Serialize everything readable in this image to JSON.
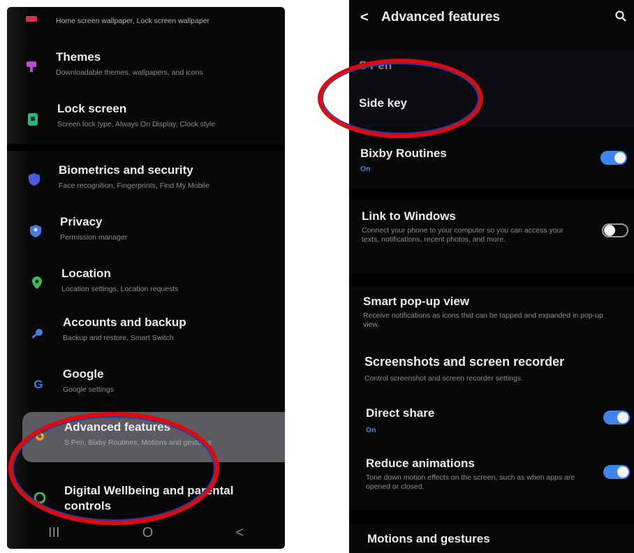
{
  "left_screen": {
    "items": [
      {
        "title": "",
        "subtitle": "Home screen wallpaper, Lock screen wallpaper",
        "icon": "wallpaper-icon",
        "color": "#d9334a"
      },
      {
        "title": "Themes",
        "subtitle": "Downloadable themes, wallpapers, and icons",
        "icon": "themes-icon",
        "color": "#b64fd6"
      },
      {
        "title": "Lock screen",
        "subtitle": "Screen lock type, Always On Display, Clock style",
        "icon": "lock-screen-icon",
        "color": "#2ab38a"
      },
      {
        "title": "Biometrics and security",
        "subtitle": "Face recognition, Fingerprints, Find My Mobile",
        "icon": "shield-icon",
        "color": "#4d5be0"
      },
      {
        "title": "Privacy",
        "subtitle": "Permission manager",
        "icon": "privacy-icon",
        "color": "#4a7ce0"
      },
      {
        "title": "Location",
        "subtitle": "Location settings, Location requests",
        "icon": "location-pin-icon",
        "color": "#3dbb56"
      },
      {
        "title": "Accounts and backup",
        "subtitle": "Backup and restore, Smart Switch",
        "icon": "key-icon",
        "color": "#3d7ee8"
      },
      {
        "title": "Google",
        "subtitle": "Google settings",
        "icon": "google-icon",
        "color": "#3d7ee8"
      },
      {
        "title": "Advanced features",
        "subtitle": "S Pen, Bixby Routines, Motions and gestures",
        "icon": "gear-icon",
        "color": "#f0a020"
      },
      {
        "title": "Digital Wellbeing and parental controls",
        "subtitle": "",
        "icon": "wellbeing-icon",
        "color": "#3dbb56"
      }
    ],
    "nav": {
      "recents": "III",
      "home": "O",
      "back": "<"
    }
  },
  "right_screen": {
    "header": {
      "back": "<",
      "title": "Advanced features",
      "search_icon": "search-icon"
    },
    "rows": [
      {
        "title": "S Pen",
        "subtitle": "",
        "toggle": null
      },
      {
        "title": "Side key",
        "subtitle": "",
        "toggle": null
      },
      {
        "title": "Bixby Routines",
        "subtitle": "On",
        "toggle": "on"
      },
      {
        "title": "Link to Windows",
        "subtitle": "Connect your phone to your computer so you can access your texts, notifications, recent photos, and more.",
        "toggle": "off"
      },
      {
        "title": "Smart pop-up view",
        "subtitle": "Receive notifications as icons that can be tapped and expanded in pop-up view.",
        "toggle": null
      },
      {
        "title": "Screenshots and screen recorder",
        "subtitle": "Control screenshot and screen recorder settings.",
        "toggle": null
      },
      {
        "title": "Direct share",
        "subtitle": "On",
        "toggle": "on"
      },
      {
        "title": "Reduce animations",
        "subtitle": "Tone down motion effects on the screen, such as when apps are opened or closed.",
        "toggle": "on"
      },
      {
        "title": "Motions and gestures",
        "subtitle": "",
        "toggle": null
      }
    ]
  },
  "colors": {
    "highlight_ring": "#e10a0a",
    "toggle_on": "#3e86ee",
    "accent_on_text": "#4a86e8"
  }
}
